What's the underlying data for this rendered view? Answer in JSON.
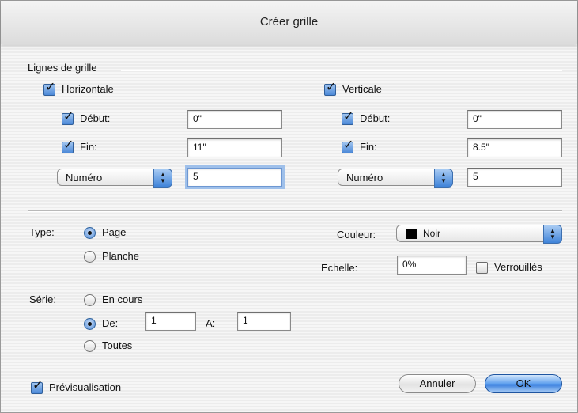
{
  "dialog": {
    "title": "Créer grille"
  },
  "grid_lines": {
    "section_label": "Lignes de grille",
    "horizontal": {
      "label": "Horizontale",
      "checked": true,
      "start": {
        "label": "Début:",
        "value": "0\""
      },
      "end": {
        "label": "Fin:",
        "value": "11\""
      },
      "mode_select": "Numéro",
      "mode_value": "5"
    },
    "vertical": {
      "label": "Verticale",
      "checked": true,
      "start": {
        "label": "Début:",
        "value": "0\""
      },
      "end": {
        "label": "Fin:",
        "value": "8.5\""
      },
      "mode_select": "Numéro",
      "mode_value": "5"
    }
  },
  "type": {
    "label": "Type:",
    "options": [
      "Page",
      "Planche"
    ],
    "selected": "Page"
  },
  "color": {
    "label": "Couleur:",
    "value": "Noir",
    "swatch": "#000000"
  },
  "scale": {
    "label": "Echelle:",
    "value": "0%"
  },
  "locked": {
    "label": "Verrouillés",
    "checked": false
  },
  "series": {
    "label": "Série:",
    "options": [
      "En cours",
      "De:",
      "Toutes"
    ],
    "selected": "De:",
    "from_value": "1",
    "to_label": "A:",
    "to_value": "1"
  },
  "preview": {
    "label": "Prévisualisation",
    "checked": true
  },
  "buttons": {
    "cancel": "Annuler",
    "ok": "OK"
  }
}
